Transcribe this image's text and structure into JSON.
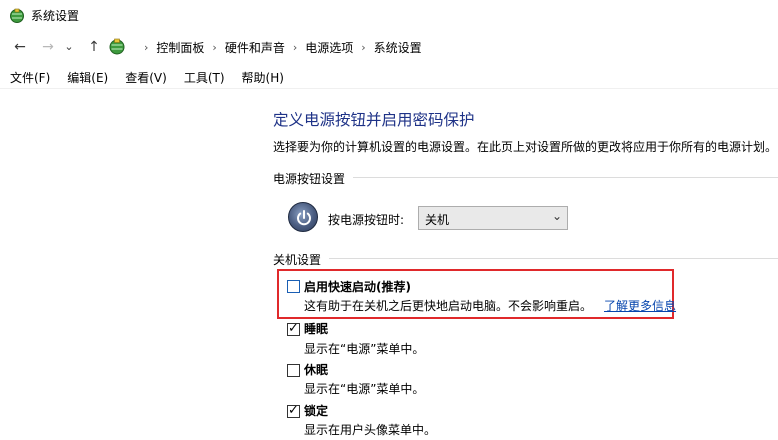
{
  "window": {
    "title": "系统设置"
  },
  "nav": {
    "back_icon": "←",
    "forward_icon": "→",
    "dropdown_icon": "⌄",
    "up_icon": "↑",
    "separator": "›",
    "breadcrumbs": [
      "控制面板",
      "硬件和声音",
      "电源选项",
      "系统设置"
    ]
  },
  "menu": {
    "items": [
      "文件(F)",
      "编辑(E)",
      "查看(V)",
      "工具(T)",
      "帮助(H)"
    ]
  },
  "main": {
    "heading": "定义电源按钮并启用密码保护",
    "description": "选择要为你的计算机设置的电源设置。在此页上对设置所做的更改将应用于你所有的电源计划。",
    "power_section": {
      "label": "电源按钮设置",
      "power_button_label": "按电源按钮时:",
      "power_button_value": "关机",
      "select_arrow": "⌄"
    },
    "shutdown_section": {
      "label": "关机设置",
      "options": [
        {
          "label": "启用快速启动(推荐)",
          "description": "这有助于在关机之后更快地启动电脑。不会影响重启。",
          "link": "了解更多信息",
          "checked": false
        },
        {
          "label": "睡眠",
          "description": "显示在“电源”菜单中。",
          "checked": true
        },
        {
          "label": "休眠",
          "description": "显示在“电源”菜单中。",
          "checked": false
        },
        {
          "label": "锁定",
          "description": "显示在用户头像菜单中。",
          "checked": true
        }
      ]
    }
  },
  "colors": {
    "heading": "#1e3287",
    "highlight_border": "#e0292b",
    "link": "#0645ad"
  }
}
